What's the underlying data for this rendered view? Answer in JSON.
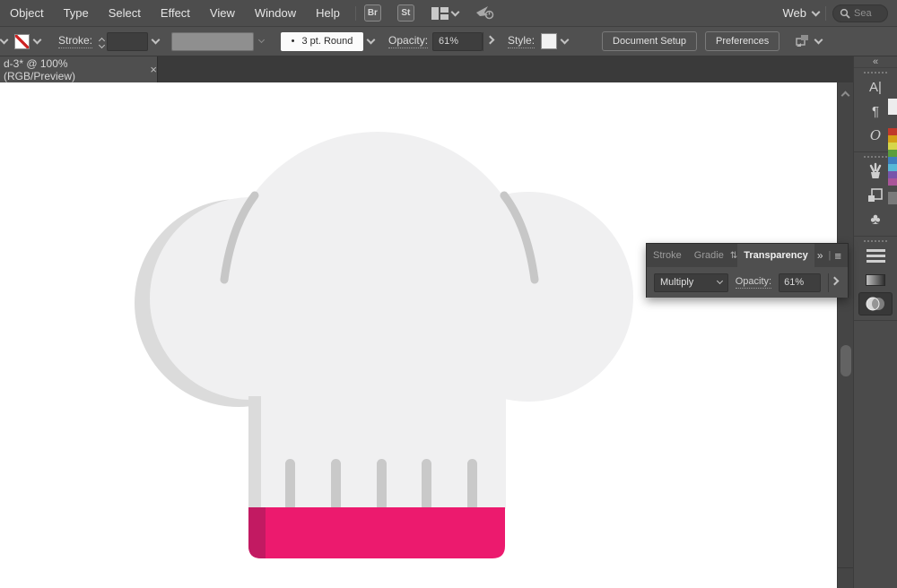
{
  "colors": {
    "accent_pink": "#EC1A6E",
    "pink_shadow": "#C21A62",
    "hat_fill": "#F0F0F1",
    "hat_shadow": "#DBDBDB",
    "crease": "#C7C7C7",
    "stitch": "#C9C9C9"
  },
  "menubar": {
    "items": [
      "Object",
      "Type",
      "Select",
      "Effect",
      "View",
      "Window",
      "Help"
    ],
    "bridge_badge": "Br",
    "stock_badge": "St",
    "workspace_label": "Web",
    "search_text": "Sea"
  },
  "control_bar": {
    "stroke_label": "Stroke:",
    "brush_bullet": "•",
    "brush_value": "3 pt. Round",
    "opacity_label": "Opacity:",
    "opacity_value": "61%",
    "style_label": "Style:",
    "document_setup_label": "Document Setup",
    "preferences_label": "Preferences"
  },
  "tabs": {
    "document_title": "d-3* @ 100% (RGB/Preview)",
    "close_glyph": "×"
  },
  "dock": {
    "collapse_glyph": "«",
    "character_glyph": "A|",
    "paragraph_glyph": "¶",
    "opentype_glyph": "O",
    "symbols_glyph": "♣"
  },
  "panel": {
    "tab_stroke": "Stroke",
    "tab_gradient": "Gradie",
    "cycle_glyph": "⇅",
    "tab_transparency": "Transparency",
    "collapse_glyph": "»",
    "divider_glyph": "|",
    "menu_glyph": "≡",
    "blend_mode": "Multiply",
    "opacity_label": "Opacity:",
    "opacity_value": "61%"
  }
}
